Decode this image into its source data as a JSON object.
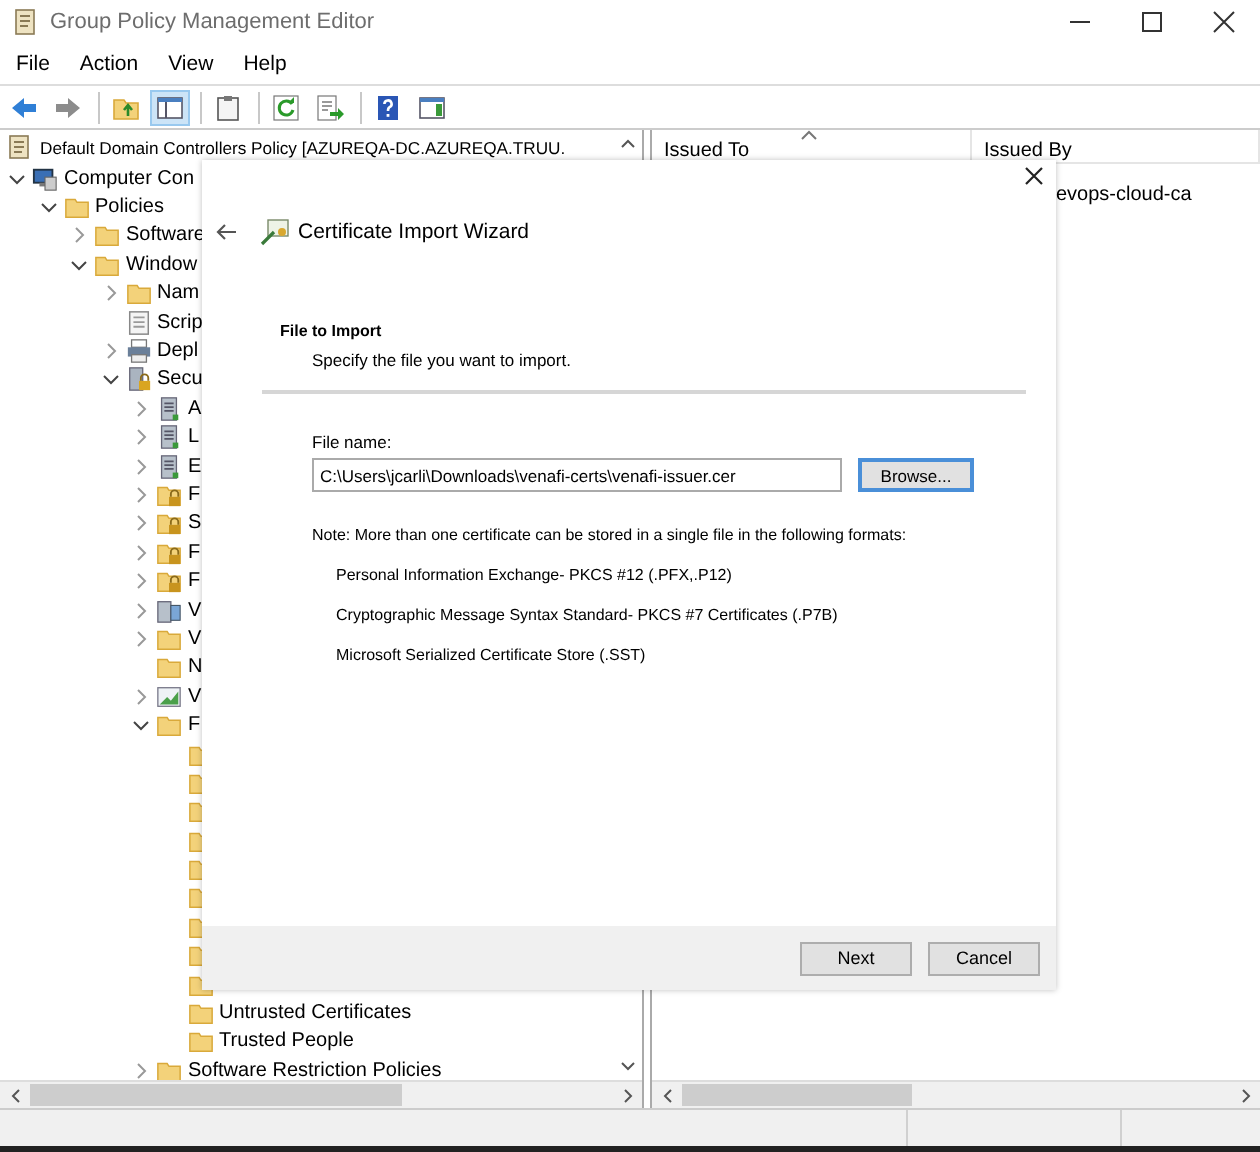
{
  "window": {
    "title": "Group Policy Management Editor"
  },
  "menu": [
    "File",
    "Action",
    "View",
    "Help"
  ],
  "toolbar": [
    [
      {
        "kind": "back",
        "pressed": false
      },
      {
        "kind": "forward",
        "pressed": false
      }
    ],
    [
      {
        "kind": "up-folder",
        "pressed": false
      },
      {
        "kind": "tree-pane",
        "pressed": true
      }
    ],
    [
      {
        "kind": "clipboard",
        "pressed": false
      }
    ],
    [
      {
        "kind": "refresh",
        "pressed": false
      },
      {
        "kind": "export",
        "pressed": false
      }
    ],
    [
      {
        "kind": "help",
        "pressed": false
      },
      {
        "kind": "action-pane",
        "pressed": false
      }
    ]
  ],
  "tree": {
    "root": "Default Domain Controllers Policy [AZUREQA-DC.AZUREQA.TRUU.",
    "items": [
      {
        "label": "Computer Con",
        "kind": "computer",
        "expanded": true,
        "children": [
          {
            "label": "Policies",
            "kind": "folder",
            "expanded": true,
            "children": [
              {
                "label": "Software",
                "kind": "folder",
                "expanded": false
              },
              {
                "label": "Window",
                "kind": "folder",
                "expanded": true,
                "children": [
                  {
                    "label": "Nam",
                    "kind": "folder",
                    "expanded": false
                  },
                  {
                    "label": "Scrip",
                    "kind": "script"
                  },
                  {
                    "label": "Depl",
                    "kind": "printer",
                    "expanded": false
                  },
                  {
                    "label": "Secu",
                    "kind": "security",
                    "expanded": true,
                    "children": [
                      {
                        "label": "A",
                        "kind": "server",
                        "expanded": false
                      },
                      {
                        "label": "L",
                        "kind": "server",
                        "expanded": false
                      },
                      {
                        "label": "E",
                        "kind": "server",
                        "expanded": false
                      },
                      {
                        "label": "F",
                        "kind": "lock-folder",
                        "expanded": false
                      },
                      {
                        "label": "S",
                        "kind": "lock-folder",
                        "expanded": false
                      },
                      {
                        "label": "F",
                        "kind": "lock-folder",
                        "expanded": false
                      },
                      {
                        "label": "F",
                        "kind": "lock-folder",
                        "expanded": false
                      },
                      {
                        "label": "V",
                        "kind": "network",
                        "expanded": false
                      },
                      {
                        "label": "V",
                        "kind": "folder",
                        "expanded": false
                      },
                      {
                        "label": "N",
                        "kind": "folder"
                      },
                      {
                        "label": "V",
                        "kind": "chart",
                        "expanded": false
                      },
                      {
                        "label": "F",
                        "kind": "folder",
                        "expanded": true,
                        "children": [
                          {
                            "kind": "folder"
                          },
                          {
                            "kind": "folder"
                          },
                          {
                            "kind": "folder"
                          },
                          {
                            "kind": "folder"
                          },
                          {
                            "kind": "folder"
                          },
                          {
                            "kind": "folder"
                          },
                          {
                            "kind": "folder"
                          },
                          {
                            "kind": "folder"
                          },
                          {
                            "kind": "folder"
                          },
                          {
                            "label": "Untrusted Certificates",
                            "kind": "folder"
                          },
                          {
                            "label": "Trusted People",
                            "kind": "folder"
                          }
                        ]
                      },
                      {
                        "label": "Software Restriction Policies",
                        "kind": "folder",
                        "expanded": false
                      }
                    ]
                  }
                ]
              }
            ]
          }
        ]
      }
    ]
  },
  "list": {
    "columns": [
      {
        "label": "Issued To",
        "sorted": true
      },
      {
        "label": "Issued By",
        "sorted": false
      }
    ],
    "rows": [
      {
        "issued_by": "evops-cloud-ca"
      }
    ]
  },
  "dialog": {
    "title": "Certificate Import Wizard",
    "heading": "File to Import",
    "subheading": "Specify the file you want to import.",
    "file_label": "File name:",
    "file_value": "C:\\Users\\jcarli\\Downloads\\venafi-certs\\venafi-issuer.cer",
    "browse": {
      "label": "Browse...",
      "focused": true
    },
    "note": "Note:  More than one certificate can be stored in a single file in the following formats:",
    "formats": [
      "Personal Information Exchange- PKCS #12 (.PFX,.P12)",
      "Cryptographic Message Syntax Standard- PKCS #7 Certificates (.P7B)",
      "Microsoft Serialized Certificate Store (.SST)"
    ],
    "buttons": [
      "Next",
      "Cancel"
    ]
  }
}
